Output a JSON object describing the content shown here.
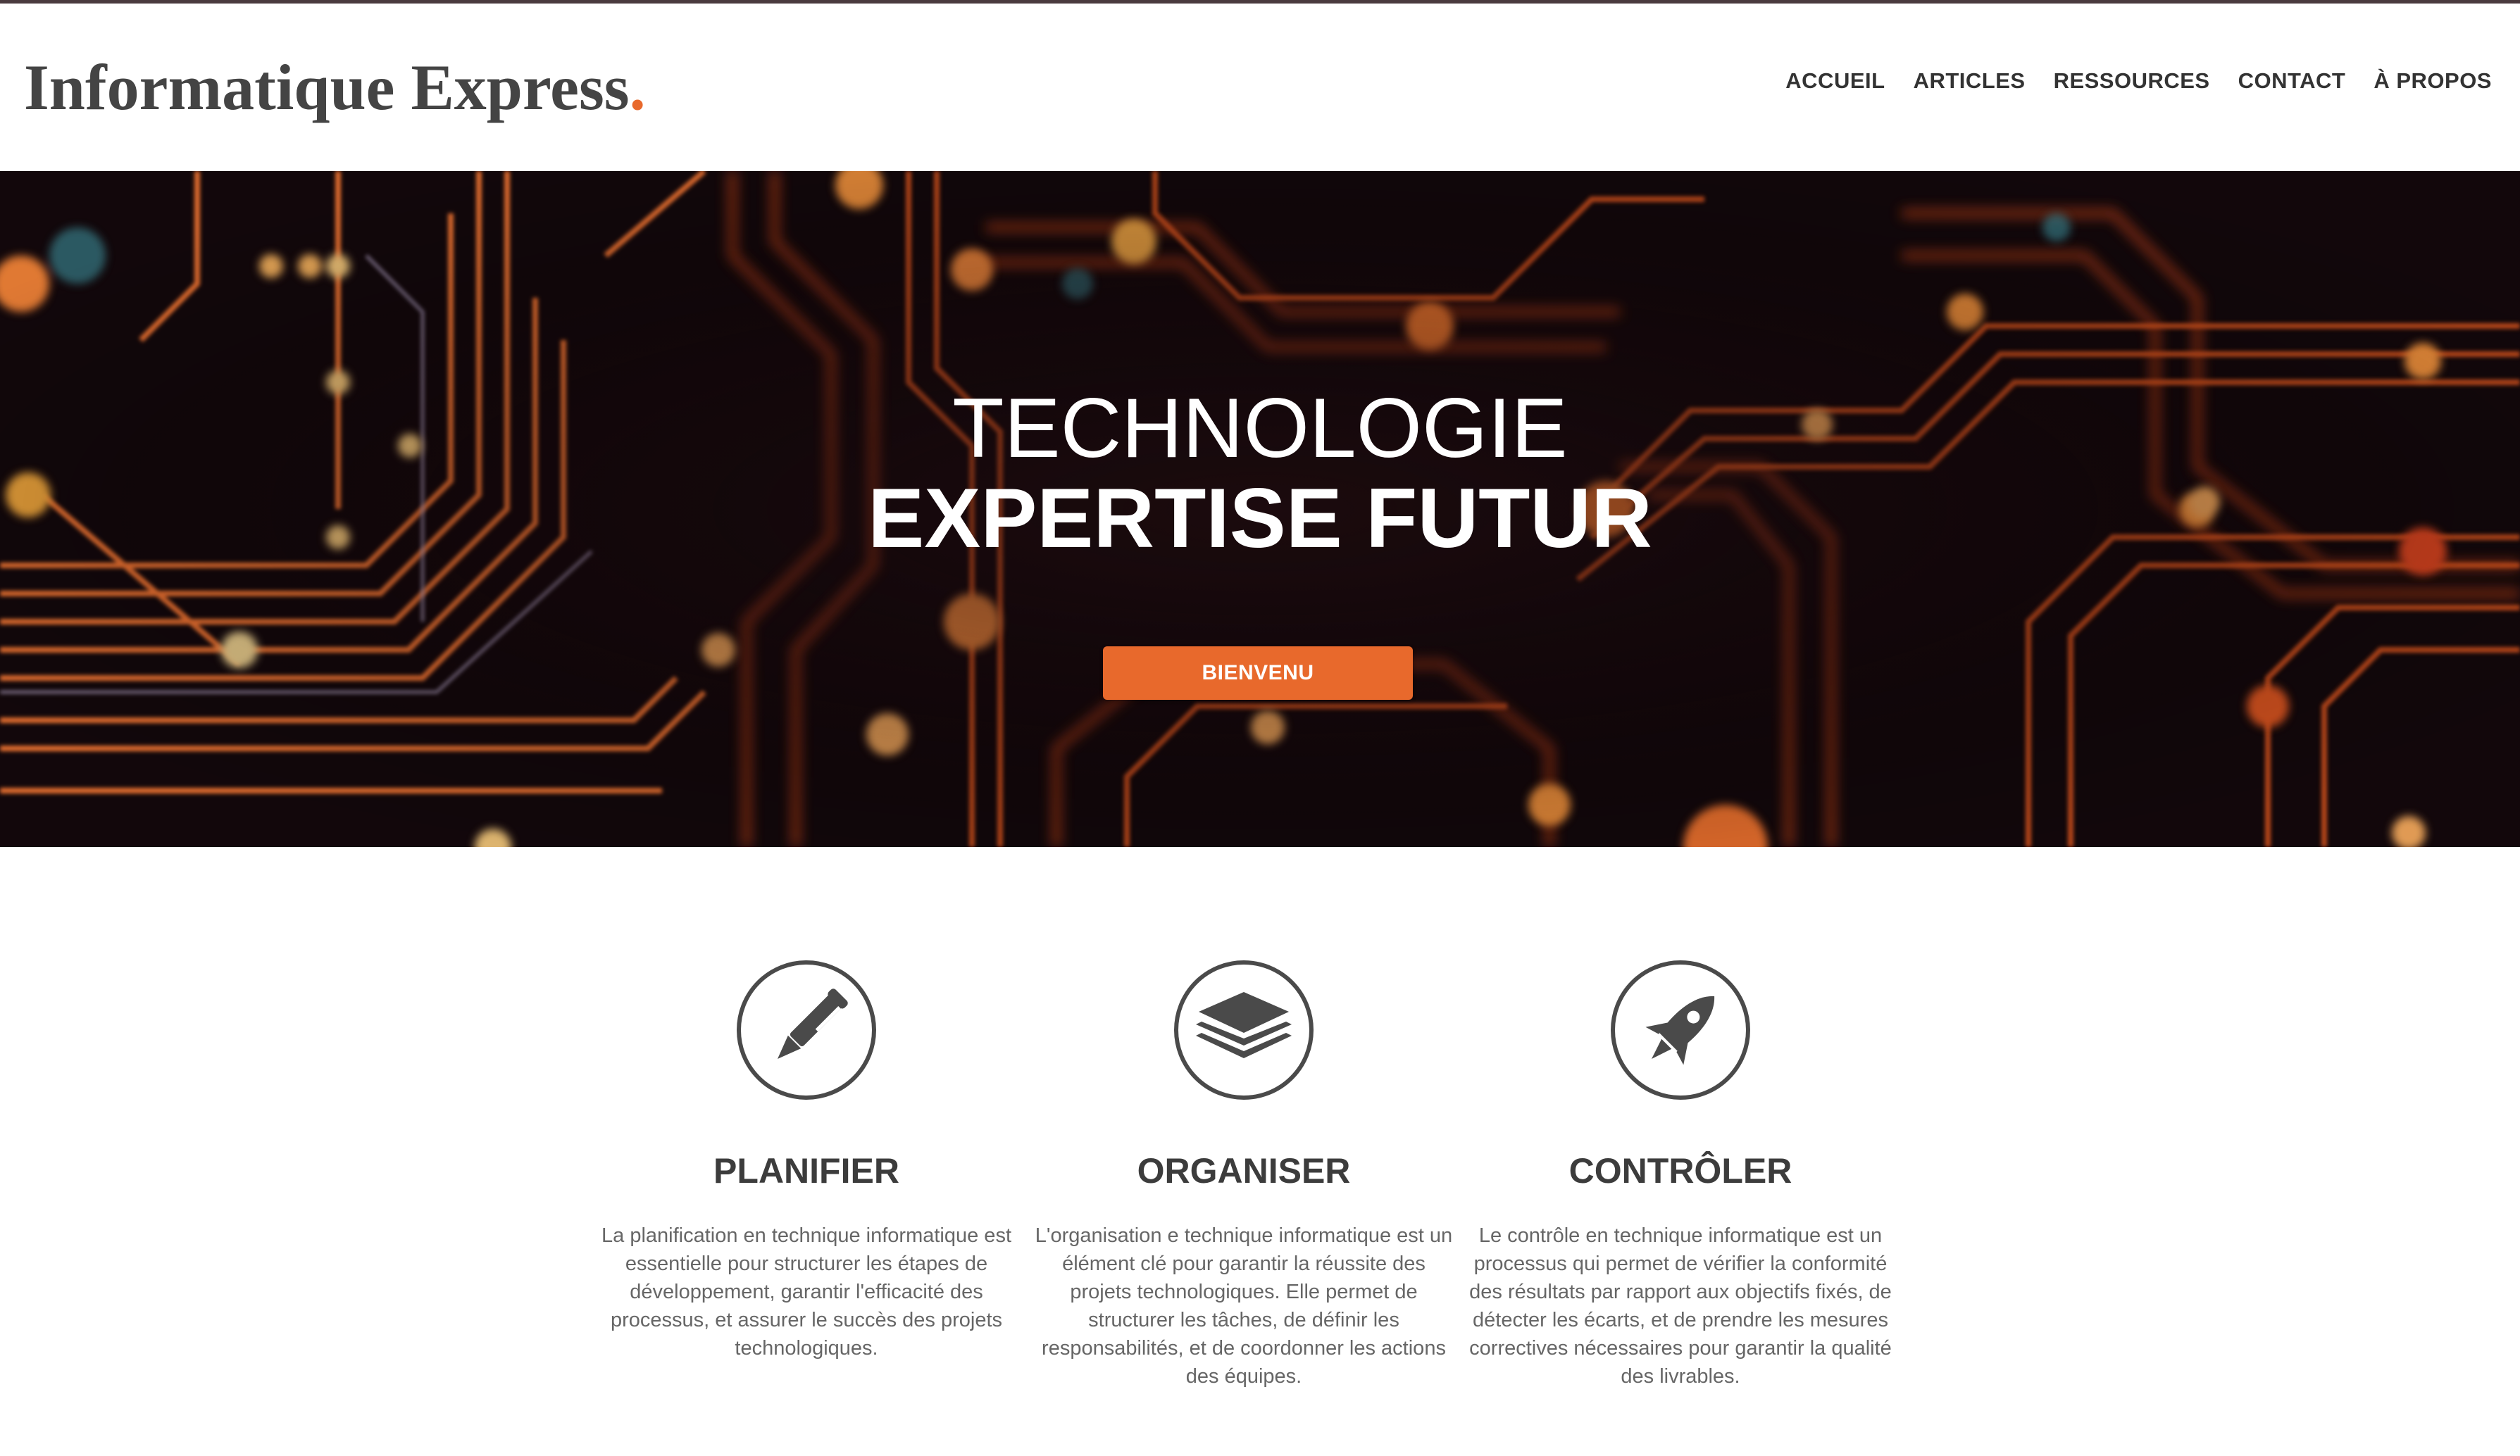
{
  "brand": {
    "name": "Informatique Express",
    "dot": ".",
    "accent_color": "#e8692c",
    "text_color": "#444444"
  },
  "nav": {
    "items": [
      {
        "label": "ACCUEIL"
      },
      {
        "label": "ARTICLES"
      },
      {
        "label": "RESSOURCES"
      },
      {
        "label": "CONTACT"
      },
      {
        "label": "À PROPOS"
      }
    ]
  },
  "hero": {
    "line1": "TECHNOLOGIE",
    "line2": "EXPERTISE FUTUR",
    "button_label": "BIENVENU",
    "background": "orange-circuit-board"
  },
  "features": [
    {
      "icon": "pen-icon",
      "title": "PLANIFIER",
      "text": "La planification en technique informatique est essentielle pour structurer les étapes de développement, garantir l'efficacité des processus, et assurer le succès des projets technologiques."
    },
    {
      "icon": "layers-icon",
      "title": "ORGANISER",
      "text": "L'organisation e technique informatique est un élément clé pour garantir la réussite des projets technologiques. Elle permet de structurer les tâches, de définir les responsabilités, et de coordonner les actions des équipes."
    },
    {
      "icon": "rocket-icon",
      "title": "CONTRÔLER",
      "text": "Le contrôle en technique informatique est un processus qui permet de vérifier la conformité des résultats par rapport aux objectifs fixés, de détecter les écarts, et de prendre les mesures correctives nécessaires pour garantir la qualité des livrables."
    }
  ]
}
